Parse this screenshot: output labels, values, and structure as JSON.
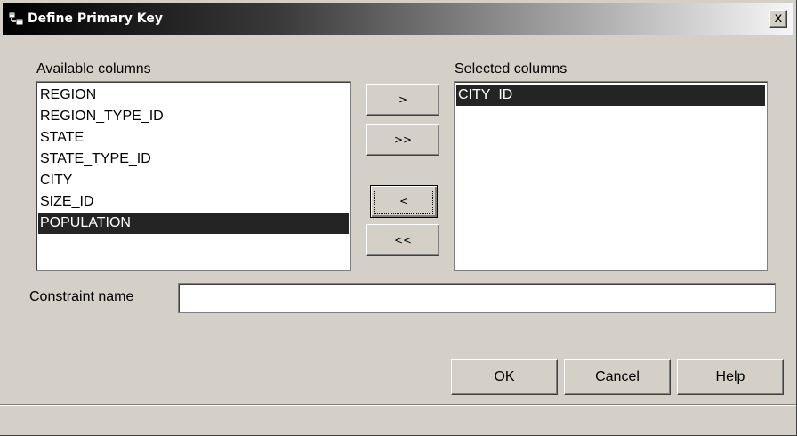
{
  "window": {
    "title": "Define Primary Key",
    "close_label": "x"
  },
  "available": {
    "label": "Available columns",
    "items": [
      "REGION",
      "REGION_TYPE_ID",
      "STATE",
      "STATE_TYPE_ID",
      "CITY",
      "SIZE_ID",
      "POPULATION"
    ],
    "selected_item": "POPULATION"
  },
  "selected": {
    "label": "Selected columns",
    "items": [
      "CITY_ID"
    ],
    "selected_item": "CITY_ID"
  },
  "move_buttons": {
    "add_one": ">",
    "add_all": ">>",
    "remove_one": "<",
    "remove_all": "<<"
  },
  "constraint": {
    "label": "Constraint name",
    "value": ""
  },
  "footer": {
    "ok": "OK",
    "cancel": "Cancel",
    "help": "Help"
  }
}
